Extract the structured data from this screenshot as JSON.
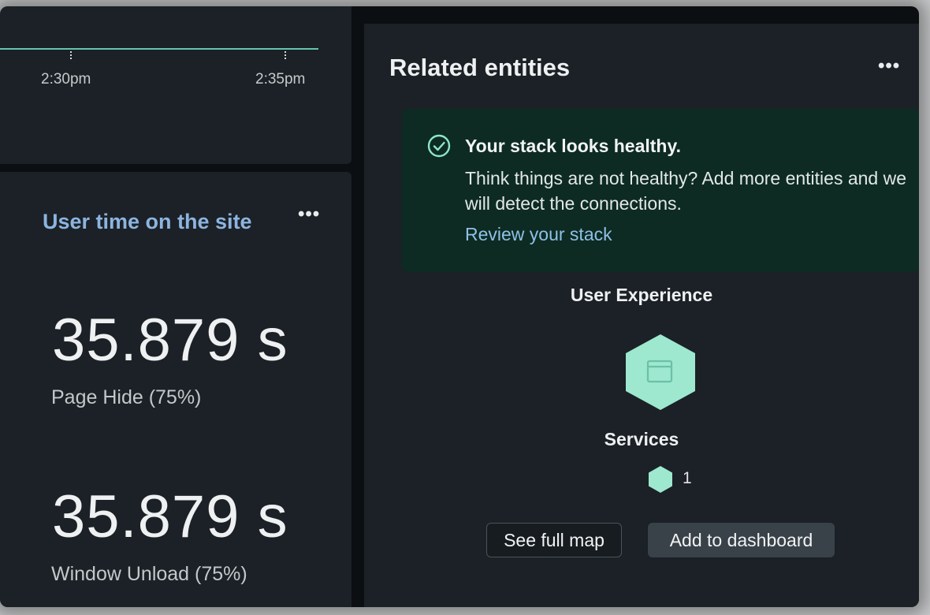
{
  "chart": {
    "x_ticks": [
      "2:30pm",
      "2:35pm"
    ],
    "line_color": "#63c5b0"
  },
  "metric_card": {
    "title": "User time on the site",
    "menu_icon": "more-horizontal-icon",
    "metrics": [
      {
        "value": "35.879 s",
        "label": "Page Hide (75%)"
      },
      {
        "value": "35.879 s",
        "label": "Window Unload (75%)"
      }
    ]
  },
  "related_entities": {
    "title": "Related entities",
    "menu_icon": "more-horizontal-icon",
    "health": {
      "icon": "check-circle-icon",
      "title": "Your stack looks healthy.",
      "text": "Think things are not healthy? Add more entities and we will detect the connections.",
      "link": "Review your stack"
    },
    "entity_group": "User Experience",
    "entity_icon": "browser-window-icon",
    "services_label": "Services",
    "services_count": "1",
    "buttons": {
      "see_full_map": "See full map",
      "add_to_dashboard": "Add to dashboard"
    },
    "collapse_icon": "chevron-right-icon"
  },
  "colors": {
    "accent": "#8db4e0",
    "healthy_bg": "#0d2b22",
    "entity": "#9de8cf",
    "link": "#8fc0e6"
  }
}
